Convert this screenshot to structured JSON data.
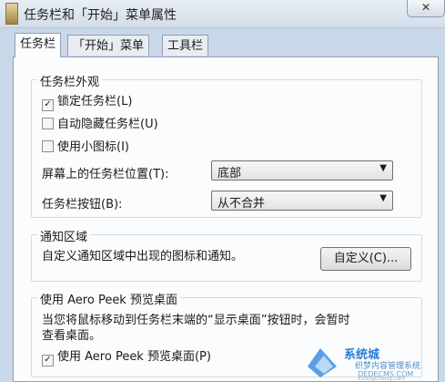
{
  "window": {
    "title": "任务栏和「开始」菜单属性",
    "close_label": "✕"
  },
  "tabs": [
    {
      "label": "任务栏",
      "active": true
    },
    {
      "label": "「开始」菜单",
      "active": false
    },
    {
      "label": "工具栏",
      "active": false
    }
  ],
  "appearance": {
    "title": "任务栏外观",
    "checkboxes": [
      {
        "label": "锁定任务栏(L)",
        "checked": true
      },
      {
        "label": "自动隐藏任务栏(U)",
        "checked": false
      },
      {
        "label": "使用小图标(I)",
        "checked": false
      }
    ],
    "position_label": "屏幕上的任务栏位置(T):",
    "position_value": "底部",
    "buttons_label": "任务栏按钮(B):",
    "buttons_value": "从不合并"
  },
  "notification": {
    "title": "通知区域",
    "description": "自定义通知区域中出现的图标和通知。",
    "customize_button": "自定义(C)..."
  },
  "aero_peek": {
    "title": "使用 Aero Peek 预览桌面",
    "desc_line1": "当您将鼠标移动到任务栏末端的“显示桌面”按钮时，会暂时",
    "desc_line2": "查看桌面。",
    "checkbox_label": "使用 Aero Peek 预览桌面(P)",
    "checkbox_checked": true
  },
  "watermark": {
    "line1": "系统城",
    "line2": "织梦内容管理系统",
    "line3": "DEDECMS.COM",
    "line4": "xitongcheng.com"
  },
  "colors": {
    "window_frame": "#c9d8e8",
    "panel": "#fbfcfd",
    "accent": "#2b7fd3"
  }
}
